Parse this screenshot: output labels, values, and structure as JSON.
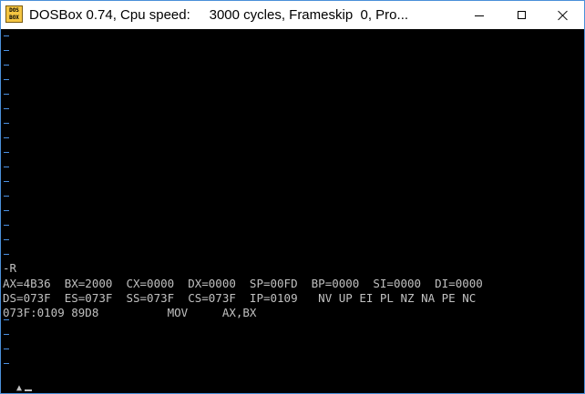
{
  "window": {
    "title": "DOSBox 0.74, Cpu speed:     3000 cycles, Frameskip  0, Pro...",
    "icon_lines": [
      "DOS",
      "BOX"
    ],
    "controls": {
      "minimize_icon": "minimize-icon",
      "maximize_icon": "maximize-icon",
      "close_icon": "close-icon"
    },
    "accent_color": "#4a90d9"
  },
  "terminal": {
    "background": "#000000",
    "text_color": "#c0c0c0",
    "dash_color": "#4a8fe0",
    "lines": [
      "-R",
      "AX=4B36  BX=2000  CX=0000  DX=0000  SP=00FD  BP=0000  SI=0000  DI=0000",
      "DS=073F  ES=073F  SS=073F  CS=073F  IP=0109   NV UP EI PL NZ NA PE NC",
      "073F:0109 89D8          MOV     AX,BX"
    ],
    "cursor_glyph": "▲"
  }
}
